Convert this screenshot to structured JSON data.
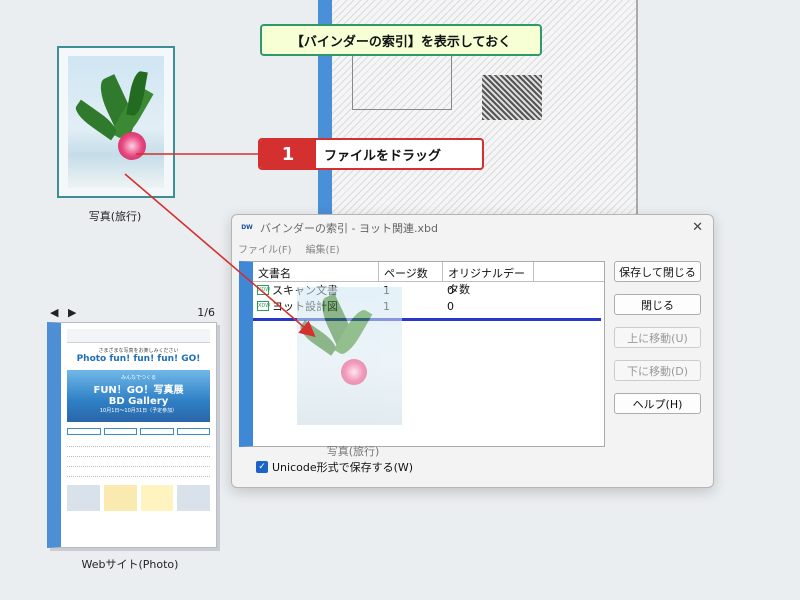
{
  "callout_top": "【バインダーの索引】を表示しておく",
  "step": {
    "number": "1",
    "text": "ファイルをドラッグ"
  },
  "desktop": {
    "photo_caption": "写真(旅行)",
    "binder_nav": {
      "prev": "◀",
      "next": "▶",
      "page": "1/6"
    },
    "binder_caption": "Webサイト(Photo)",
    "web_preview": {
      "line1": "さまざまな写真をお楽しみください",
      "title": "Photo fun! fun! fun! GO!",
      "banner_small": "みんなでつくる",
      "banner_line1": "FUN！GO！写真展",
      "banner_line2": "BD Gallery",
      "banner_date": "10月1日～10月31日（予定参加）"
    }
  },
  "dialog": {
    "app_icon": "DW",
    "title": "バインダーの索引 - ヨット関連.xbd",
    "close": "✕",
    "menu": [
      "ファイル(F)",
      "編集(E)"
    ],
    "columns": {
      "name": "文書名",
      "pages": "ページ数",
      "original": "オリジナルデータ数"
    },
    "rows": [
      {
        "icon": "XDW",
        "name": "スキャン文書",
        "pages": "1",
        "original": "0"
      },
      {
        "icon": "XDW",
        "name": "ヨット設計図",
        "pages": "1",
        "original": "0"
      }
    ],
    "drag_caption": "写真(旅行)",
    "buttons": {
      "save_close": "保存して閉じる",
      "close": "閉じる",
      "move_up": "上に移動(U)",
      "move_down": "下に移動(D)",
      "help": "ヘルプ(H)"
    },
    "checkbox_label": "Unicode形式で保存する(W)",
    "checkbox_checked": true
  },
  "colors": {
    "accent_red": "#d4302f",
    "callout_green": "#2e9a6c",
    "binder_blue": "#3f88d6",
    "insert_line": "#2837c8"
  }
}
